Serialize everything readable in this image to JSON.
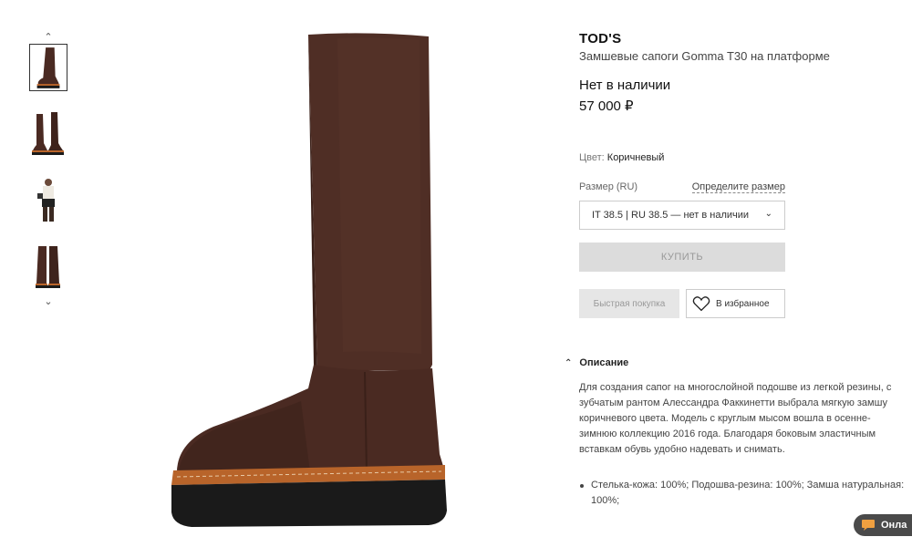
{
  "product": {
    "brand": "TOD'S",
    "name": "Замшевые сапоги Gomma T30 на платформе",
    "stock_status": "Нет в наличии",
    "price": "57 000 ₽",
    "color_label": "Цвет:",
    "color_value": "Коричневый"
  },
  "size": {
    "label": "Размер (RU)",
    "guide_link": "Определите размер",
    "selected": "IT 38.5 | RU 38.5 — нет в наличии"
  },
  "actions": {
    "buy": "КУПИТЬ",
    "quick_buy": "Быстрая покупка",
    "favorite": "В избранное"
  },
  "description": {
    "heading": "Описание",
    "text": "Для создания сапог на многослойной подошве из легкой резины, с зубчатым рантом Алессандра Факкинетти выбрала мягкую замшу коричневого цвета. Модель с круглым мысом вошла в осенне-зимнюю коллекцию 2016 года. Благодаря боковым эластичным вставкам обувь удобно надевать и снимать.",
    "bullets": [
      "Стелька-кожа: 100%; Подошва-резина: 100%; Замша натуральная: 100%;"
    ]
  },
  "chat": {
    "label": "Онла"
  },
  "thumbnails": {
    "up_icon": "chevron-up-icon",
    "down_icon": "chevron-down-icon",
    "count": 4,
    "selected_index": 0
  },
  "colors": {
    "suede": "#4a2a22",
    "welt": "#b8642a",
    "sole": "#1a1a1a",
    "buy_bg": "#dcdcdc",
    "chat_bg": "#4a4a4a"
  }
}
